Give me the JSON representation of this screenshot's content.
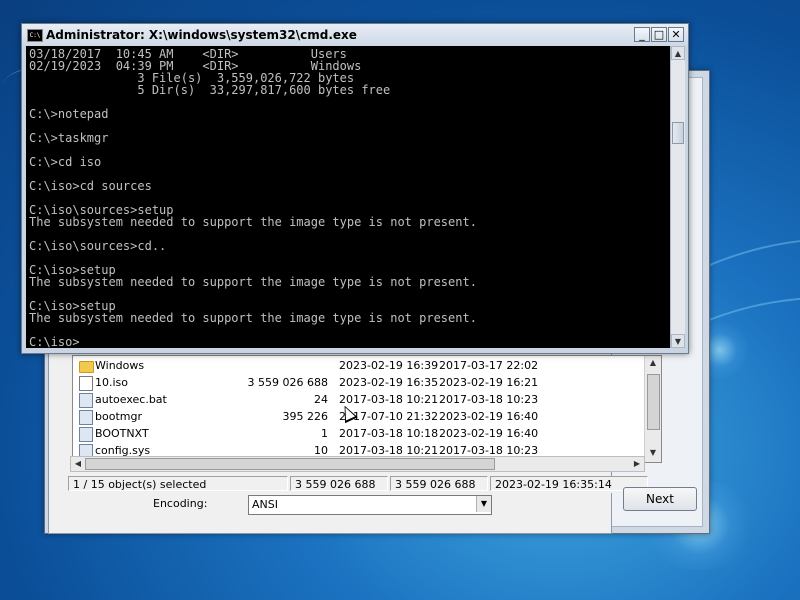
{
  "desktop": {
    "wallpaper": "windows-7-default"
  },
  "setup_window": {
    "next_label": "Next"
  },
  "open_dialog": {
    "files": [
      {
        "name": "Windows",
        "icon": "folder-icon",
        "size": "",
        "modified": "2023-02-19 16:39",
        "created": "2017-03-17 22:02"
      },
      {
        "name": "10.iso",
        "icon": "file-icon",
        "size": "3 559 026 688",
        "modified": "2023-02-19 16:35",
        "created": "2023-02-19 16:21"
      },
      {
        "name": "autoexec.bat",
        "icon": "batch-file-icon",
        "size": "24",
        "modified": "2017-03-18 10:21",
        "created": "2017-03-18 10:23"
      },
      {
        "name": "bootmgr",
        "icon": "system-file-icon",
        "size": "395 226",
        "modified": "2017-07-10 21:32",
        "created": "2023-02-19 16:40"
      },
      {
        "name": "BOOTNXT",
        "icon": "system-file-icon",
        "size": "1",
        "modified": "2017-03-18 10:18",
        "created": "2023-02-19 16:40"
      },
      {
        "name": "config.sys",
        "icon": "system-file-icon",
        "size": "10",
        "modified": "2017-03-18 10:21",
        "created": "2017-03-18 10:23"
      }
    ],
    "status": {
      "selection": "1 / 15 object(s) selected",
      "size1": "3 559 026 688",
      "size2": "3 559 026 688",
      "date": "2023-02-19 16:35:14"
    },
    "encoding_label": "Encoding:",
    "encoding_value": "ANSI"
  },
  "cmd": {
    "title": "Administrator: X:\\windows\\system32\\cmd.exe",
    "icon_text": "C:\\",
    "lines": [
      "03/18/2017  10:45 AM    <DIR>          Users",
      "02/19/2023  04:39 PM    <DIR>          Windows",
      "               3 File(s)  3,559,026,722 bytes",
      "               5 Dir(s)  33,297,817,600 bytes free",
      "",
      "C:\\>notepad",
      "",
      "C:\\>taskmgr",
      "",
      "C:\\>cd iso",
      "",
      "C:\\iso>cd sources",
      "",
      "C:\\iso\\sources>setup",
      "The subsystem needed to support the image type is not present.",
      "",
      "C:\\iso\\sources>cd..",
      "",
      "C:\\iso>setup",
      "The subsystem needed to support the image type is not present.",
      "",
      "C:\\iso>setup",
      "The subsystem needed to support the image type is not present.",
      "",
      "C:\\iso>"
    ],
    "buttons": {
      "minimize": "_",
      "maximize": "□",
      "close": "✕"
    }
  }
}
